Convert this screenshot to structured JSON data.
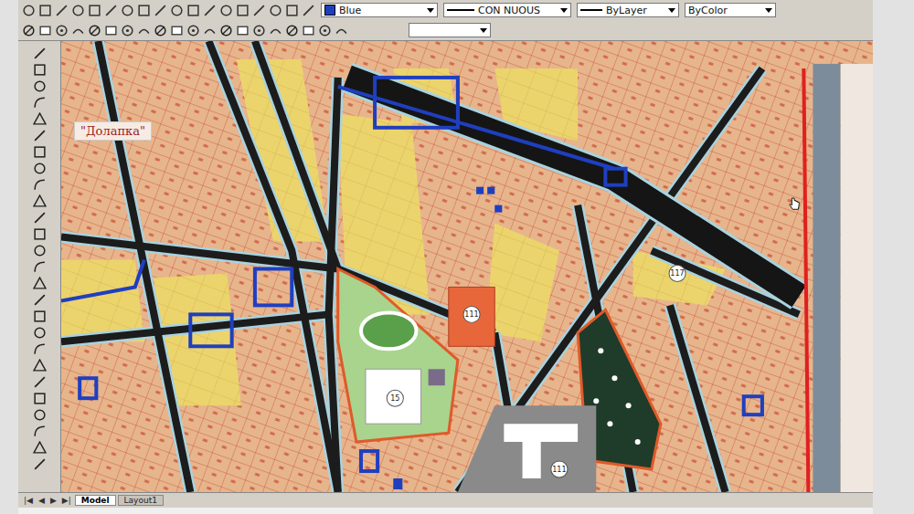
{
  "toolbar": {
    "color_dropdown": {
      "value": "Blue",
      "swatch": "#1f3fbf"
    },
    "linetype_dropdown": {
      "value": "CON  NUOUS"
    },
    "lineweight_dropdown": {
      "value": "ByLayer"
    },
    "plotstyle_dropdown": {
      "value": "ByColor"
    }
  },
  "map": {
    "place_label": "\"Долапка\"",
    "markers": [
      {
        "label": "111"
      },
      {
        "label": "15"
      },
      {
        "label": "117"
      },
      {
        "label": "111"
      }
    ]
  },
  "tab_nav": [
    "|◀",
    "◀",
    "▶",
    "▶|"
  ],
  "tabs": [
    {
      "label": "Model",
      "selected": true
    },
    {
      "label": "Layout1",
      "selected": false
    }
  ]
}
